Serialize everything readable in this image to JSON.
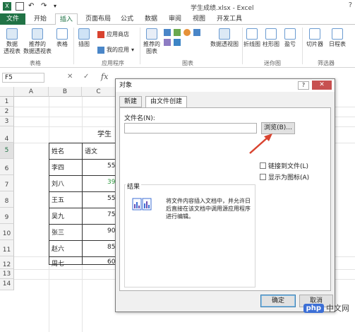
{
  "window": {
    "title": "学生成绩.xlsx - Excel"
  },
  "tabs": [
    "文件",
    "开始",
    "插入",
    "页面布局",
    "公式",
    "数据",
    "审阅",
    "视图",
    "开发工具"
  ],
  "ribbon": {
    "tables": {
      "pivot": "数据\n透视表",
      "recommended_pivot": "推荐的\n数据透视表",
      "table": "表格",
      "group": "表格"
    },
    "illustrations": {
      "label": "插图"
    },
    "apps": {
      "store": "应用商店",
      "my_apps": "我的应用",
      "group": "应用程序"
    },
    "charts": {
      "recommended": "推荐的\n图表",
      "pivot_chart": "数据透视图",
      "group": "图表"
    },
    "sparklines": {
      "line": "折线图",
      "column": "柱形图",
      "winloss": "盈亏",
      "group": "迷你图"
    },
    "filters": {
      "slicer": "切片器",
      "timeline": "日程表",
      "group": "筛选器"
    }
  },
  "formula_bar": {
    "name_box": "F5",
    "cancel": "✕",
    "enter": "✓",
    "fx": "fx"
  },
  "sheet": {
    "columns": [
      "A",
      "B",
      "C"
    ],
    "rows": [
      "1",
      "2",
      "3",
      "4",
      "5",
      "6",
      "7",
      "8",
      "9",
      "10",
      "11",
      "12",
      "13",
      "14"
    ],
    "title_partial": "学生",
    "headers": [
      "姓名",
      "语文"
    ],
    "students": [
      {
        "name": "李四",
        "score": "55"
      },
      {
        "name": "刘八",
        "score": "39"
      },
      {
        "name": "王五",
        "score": "55"
      },
      {
        "name": "吴九",
        "score": "75"
      },
      {
        "name": "张三",
        "score": "90"
      },
      {
        "name": "赵六",
        "score": "85"
      },
      {
        "name": "周七",
        "score": "60"
      }
    ]
  },
  "dialog": {
    "title": "对象",
    "help": "?",
    "close": "✕",
    "tabs": [
      "新建",
      "由文件创建"
    ],
    "filename_label": "文件名(N):",
    "browse": "浏览(B)...",
    "link_file": "链接到文件(L)",
    "show_icon": "显示为图标(A)",
    "result_label": "结果",
    "result_text": "将文件内容插入文档中，并允许日后直接在该文档中调用源应用程序进行编辑。",
    "ok": "确定",
    "cancel": "取消"
  },
  "watermark": {
    "badge": "php",
    "text": "中文网"
  },
  "colors": {
    "excel_green": "#217346",
    "arrow_red": "#d9432f"
  }
}
